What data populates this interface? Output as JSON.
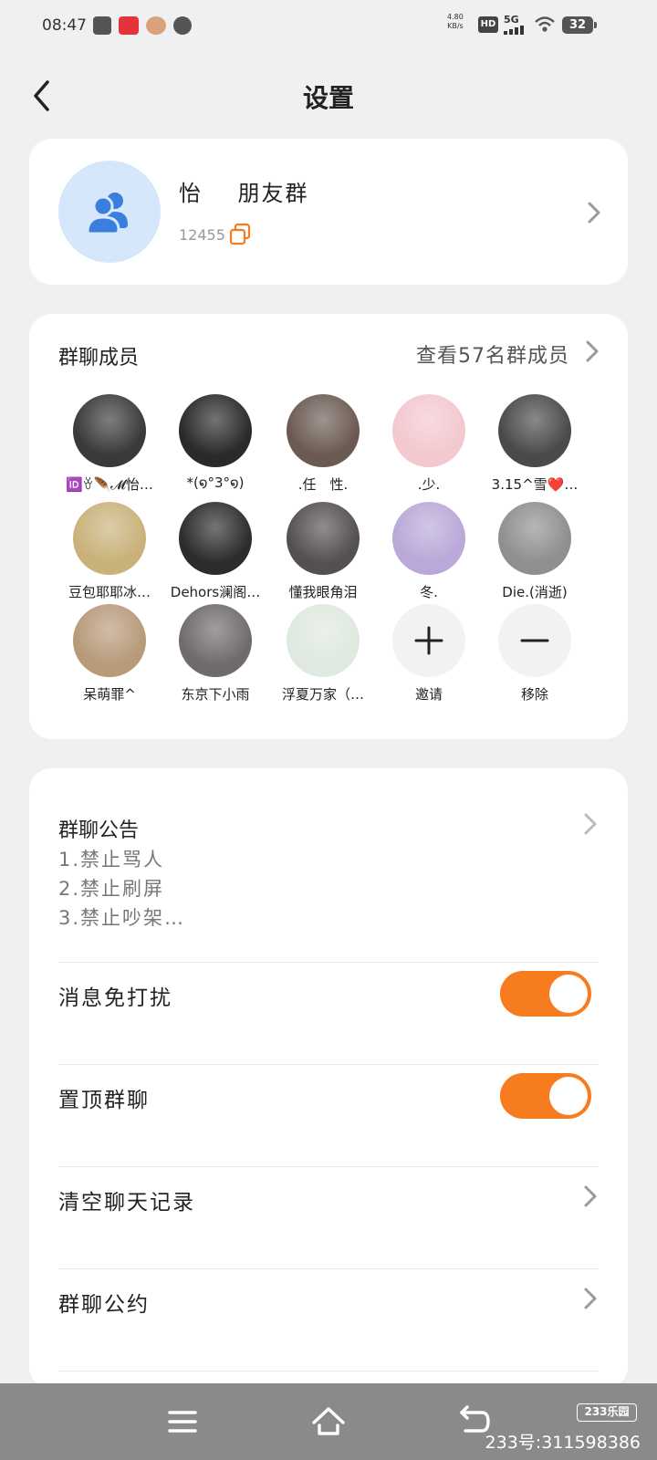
{
  "status_bar": {
    "time": "08:47",
    "net_speed_value": "4.80",
    "net_speed_unit": "KB/s",
    "hd": "HD",
    "network": "5G",
    "battery": "32"
  },
  "header": {
    "title": "设置"
  },
  "group": {
    "name": "怡    朋友群",
    "id": "12455"
  },
  "members": {
    "title": "群聊成员",
    "view_all": "查看57名群成员",
    "list": [
      {
        "name": "🆔ꈊ🪶𝓜怡…",
        "color": "#3a3a3a"
      },
      {
        "name": "*(໑°3°໑)",
        "color": "#2a2a2a"
      },
      {
        "name": ".任　性.",
        "color": "#6b5a52"
      },
      {
        "name": ".少.",
        "color": "#f3c8cf"
      },
      {
        "name": "3.15^雪❤️…",
        "color": "#4a4a4a"
      },
      {
        "name": "豆包耶耶冰…",
        "color": "#c9b27a"
      },
      {
        "name": "Dehors澜阁…",
        "color": "#2c2c2c"
      },
      {
        "name": "懂我眼角泪",
        "color": "#555050"
      },
      {
        "name": "冬.",
        "color": "#b9a8d8"
      },
      {
        "name": "Die.(消逝)",
        "color": "#8f8f8f"
      },
      {
        "name": "呆萌罪^",
        "color": "#b89a7a"
      },
      {
        "name": "东京下小雨",
        "color": "#6f6a6d"
      },
      {
        "name": "浮夏万家（…",
        "color": "#dfe9df"
      }
    ],
    "invite_label": "邀请",
    "remove_label": "移除"
  },
  "settings": {
    "notice_title": "群聊公告",
    "notice_lines": [
      "1.禁止骂人",
      "2.禁止刷屏",
      "3.禁止吵架…"
    ],
    "mute_label": "消息免打扰",
    "mute_on": true,
    "pin_label": "置顶群聊",
    "pin_on": true,
    "clear_label": "清空聊天记录",
    "rules_label": "群聊公约"
  },
  "watermark": {
    "logo": "233乐园",
    "text": "233号:311598386"
  },
  "colors": {
    "accent": "#f77c1f",
    "group_avatar_bg": "#d6e7fb",
    "group_avatar_icon": "#3a7fe0"
  }
}
